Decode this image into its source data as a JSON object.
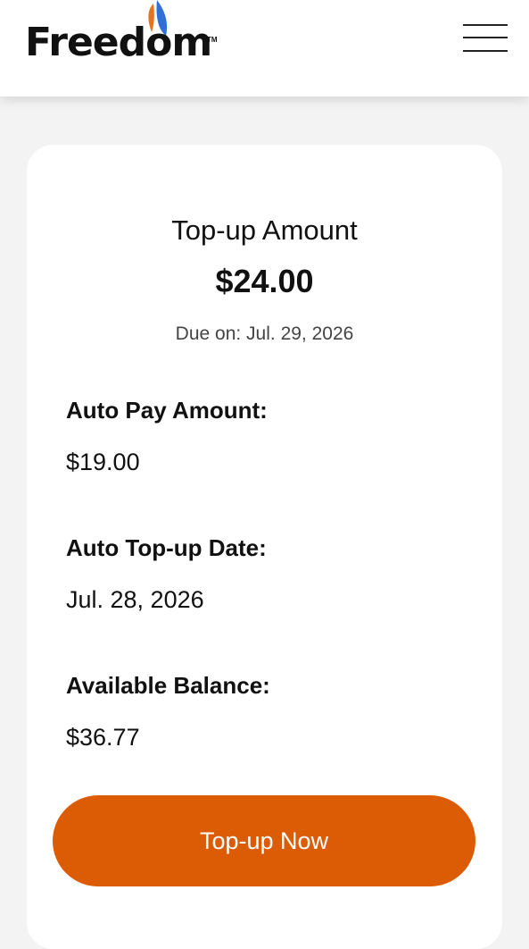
{
  "brand": {
    "name": "Freedom",
    "trademark": "TM",
    "accent_orange": "#dc5c06",
    "logo_blue": "#2f6fd6",
    "logo_orange": "#e9731c"
  },
  "header": {
    "menu_icon": "hamburger-menu-icon"
  },
  "summary": {
    "topup_label": "Top-up Amount",
    "topup_amount": "$24.00",
    "due_on": "Due on: Jul. 29, 2026"
  },
  "details": [
    {
      "label": "Auto Pay Amount:",
      "value": "$19.00"
    },
    {
      "label": "Auto Top-up Date:",
      "value": "Jul. 28, 2026"
    },
    {
      "label": "Available Balance:",
      "value": "$36.77"
    }
  ],
  "actions": {
    "topup_now": "Top-up Now"
  }
}
